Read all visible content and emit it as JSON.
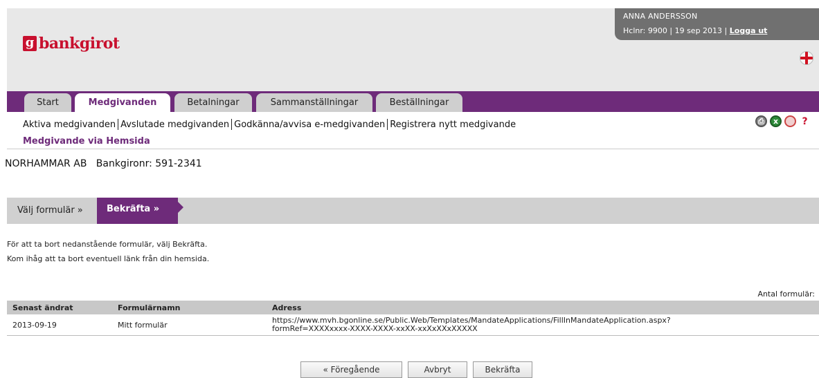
{
  "brand": {
    "mark": "g",
    "name": "bankgirot"
  },
  "user": {
    "name": "ANNA ANDERSSON",
    "info": "Hclnr: 9900 | 19 sep 2013 | ",
    "logout": "Logga ut"
  },
  "tabs": [
    "Start",
    "Medgivanden",
    "Betalningar",
    "Sammanställningar",
    "Beställningar"
  ],
  "active_tab": "Medgivanden",
  "subnav": {
    "items": [
      "Aktiva medgivanden",
      "Avslutade medgivanden",
      "Godkänna/avvisa e-medgivanden",
      "Registrera nytt medgivande"
    ],
    "current": "Medgivande via Hemsida"
  },
  "toolbar_icons": [
    "print-icon",
    "excel-icon",
    "pdf-icon",
    "help-icon"
  ],
  "company": {
    "line": "NORHAMMAR AB   Bankgironr: 591-2341"
  },
  "steps": {
    "step1": "Välj formulär »",
    "step2": "Bekräfta »"
  },
  "message": {
    "line1": "För att ta bort nedanstående formulär, välj Bekräfta.",
    "line2": "Kom ihåg att ta bort eventuell länk från din hemsida."
  },
  "form_count_label": "Antal formulär:",
  "table": {
    "headers": [
      "Senast ändrat",
      "Formulärnamn",
      "Adress"
    ],
    "rows": [
      {
        "date": "2013-09-19",
        "name": "Mitt formulär",
        "address_line1": "https://www.mvh.bgonline.se/Public.Web/Templates/MandateApplications/FillInMandateApplication.aspx?",
        "address_line2": "formRef=XXXXxxxx-XXXX-XXXX-xxXX-xxXxXXxXXXXX"
      }
    ]
  },
  "buttons": {
    "previous": "« Föregående",
    "cancel": "Avbryt",
    "confirm": "Bekräfta"
  },
  "colors": {
    "brand_purple": "#6e2b7a",
    "brand_red": "#c8102e",
    "tab_gray": "#cfcfcf"
  }
}
